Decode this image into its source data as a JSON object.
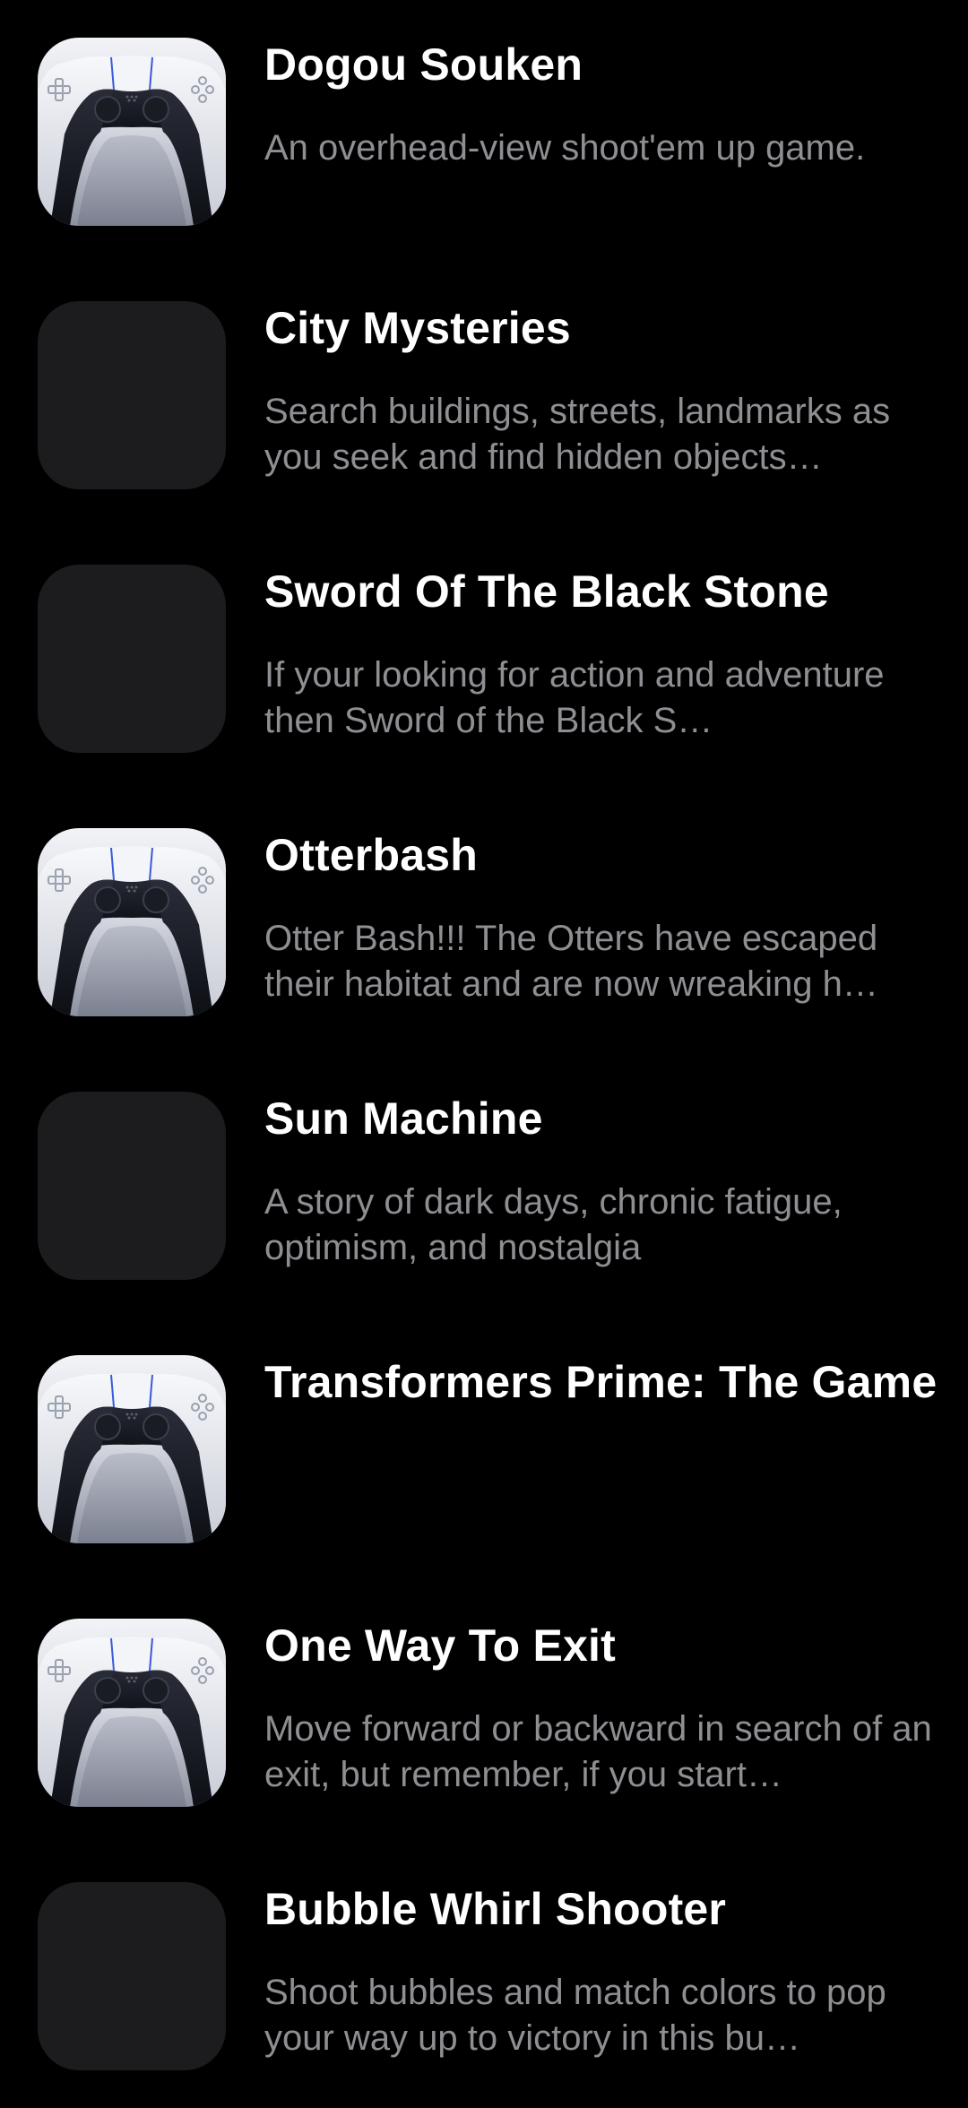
{
  "colors": {
    "background": "#000000",
    "title": "#ffffff",
    "description": "#8e8e93",
    "placeholder_thumb": "#1c1c1e"
  },
  "games": [
    {
      "title": "Dogou Souken",
      "description": "An overhead-view shoot'em up game.",
      "icon": "gamepad-icon"
    },
    {
      "title": "City Mysteries",
      "description": "Search buildings, streets, landmarks as you seek and find hidden objects…",
      "icon": null
    },
    {
      "title": "Sword Of The Black Stone",
      "description": "If your looking for action and adventure then Sword of the Black S…",
      "icon": null
    },
    {
      "title": "Otterbash",
      "description": "Otter Bash!!! The Otters have escaped their habitat and are now wreaking h…",
      "icon": "gamepad-icon"
    },
    {
      "title": "Sun Machine",
      "description": "A story of dark days, chronic fatigue, optimism, and nostalgia",
      "icon": null
    },
    {
      "title": "Transformers Prime: The Game",
      "description": "",
      "icon": "gamepad-icon"
    },
    {
      "title": "One Way To Exit",
      "description": "Move forward or backward in search of an exit, but remember, if you start…",
      "icon": "gamepad-icon"
    },
    {
      "title": "Bubble Whirl Shooter",
      "description": "Shoot bubbles and match colors to pop your way up to victory in this bu…",
      "icon": null
    }
  ]
}
